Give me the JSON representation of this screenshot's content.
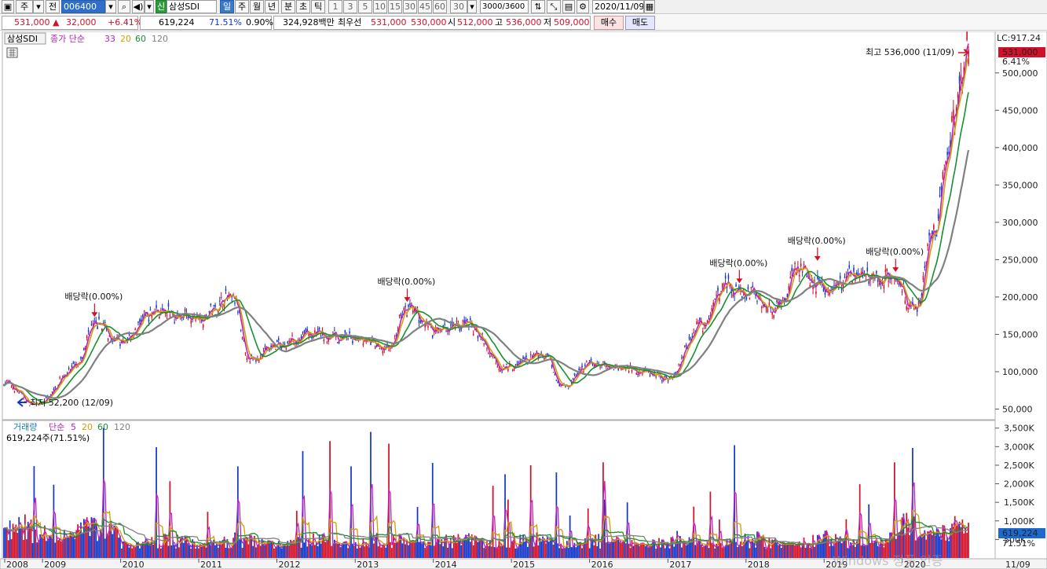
{
  "toolbar": {
    "market": "주",
    "prev_label": "전",
    "code": "006400",
    "stock_badge": "신",
    "stock_name": "삼성SDI",
    "periods": [
      "일",
      "주",
      "월",
      "년",
      "분",
      "초",
      "틱"
    ],
    "active_period": "일",
    "intervals": [
      "1",
      "3",
      "5",
      "10",
      "15",
      "30",
      "45",
      "60"
    ],
    "interval_value": "30",
    "count": "3000",
    "count_max": "3600",
    "date": "2020/11/09"
  },
  "quote": {
    "price": "531,000",
    "change": "32,000",
    "change_pct": "+6.41%",
    "volume": "619,224",
    "volume_ratio": "71.51%",
    "turnover": "0.90%",
    "amount": "324,928백만",
    "best_bid_label": "최우선",
    "best_ask": "531,000",
    "best_bid": "530,000",
    "open_label": "시",
    "open": "512,000",
    "high_label": "고",
    "high": "536,000",
    "low_label": "저",
    "low": "509,000",
    "buy_label": "매수",
    "sell_label": "매도"
  },
  "price_panel": {
    "name_tag": "삼성SDI",
    "ma_prefix": "종가 단순",
    "ma_periods": [
      "33",
      "20",
      "60",
      "120"
    ],
    "ma_colors": [
      "#c020c0",
      "#d0a000",
      "#189030",
      "#808080"
    ],
    "lc_label": "LC:917.24",
    "current_price": "531,000",
    "current_pct": "6.41%",
    "high_annotation": "최고 536,000 (11/09)",
    "low_annotation": "최저 52,200 (12/09)",
    "dividend_label": "배당락(0.00%)",
    "y_ticks": [
      "500,000",
      "450,000",
      "400,000",
      "350,000",
      "300,000",
      "250,000",
      "200,000",
      "150,000",
      "100,000",
      "50,000"
    ]
  },
  "volume_panel": {
    "title": "거래량",
    "ma_prefix": "단순",
    "ma_periods": [
      "5",
      "20",
      "60",
      "120"
    ],
    "ma_colors": [
      "#c020c0",
      "#d0a000",
      "#189030",
      "#808080"
    ],
    "current": "619,224주(71.51%)",
    "current_value": "619,224",
    "current_pct": "71.51%",
    "y_ticks": [
      "3,500K",
      "3,000K",
      "2,500K",
      "2,000K",
      "1,500K",
      "1,000K",
      "500K"
    ]
  },
  "x_axis": {
    "labels": [
      "2008",
      "2009",
      "2010",
      "2011",
      "2012",
      "2013",
      "2014",
      "2015",
      "2016",
      "2017",
      "2018",
      "2019",
      "2020"
    ],
    "last_label": "11/09"
  },
  "watermark": "Windows 정품 인증",
  "colors": {
    "up": "#d2102a",
    "down": "#1437c8",
    "accent": "#2f6fc8"
  },
  "chart_data": {
    "type": "line",
    "title": "",
    "xlabel": "",
    "ylabel": "",
    "ylim": [
      40000,
      545000
    ],
    "x": [
      "2008-07",
      "2008-12",
      "2009-06",
      "2009-09",
      "2010-01",
      "2010-06",
      "2011-01",
      "2011-06",
      "2011-09",
      "2012-01",
      "2012-06",
      "2013-01",
      "2013-06",
      "2013-09",
      "2014-01",
      "2014-06",
      "2014-12",
      "2015-06",
      "2015-09",
      "2016-01",
      "2016-06",
      "2016-10",
      "2017-01",
      "2017-06",
      "2017-10",
      "2018-01",
      "2018-06",
      "2018-09",
      "2019-01",
      "2019-06",
      "2019-12",
      "2020-03",
      "2020-06",
      "2020-09",
      "2020-11"
    ],
    "series": [
      {
        "name": "종가",
        "values": [
          85000,
          55000,
          105000,
          165000,
          140000,
          180000,
          170000,
          200000,
          115000,
          135000,
          150000,
          145000,
          130000,
          185000,
          155000,
          165000,
          105000,
          125000,
          80000,
          110000,
          105000,
          100000,
          90000,
          160000,
          215000,
          205000,
          185000,
          240000,
          210000,
          230000,
          225000,
          180000,
          290000,
          430000,
          531000
        ]
      }
    ],
    "volume_ylim": [
      0,
      3600000
    ],
    "annotations": [
      {
        "label": "배당락(0.00%)",
        "x": "2009-09",
        "price": 165000
      },
      {
        "label": "배당락(0.00%)",
        "x": "2013-09",
        "price": 185000
      },
      {
        "label": "배당락(0.00%)",
        "x": "2017-12",
        "price": 210000
      },
      {
        "label": "배당락(0.00%)",
        "x": "2018-12",
        "price": 240000
      },
      {
        "label": "배당락(0.00%)",
        "x": "2019-12",
        "price": 225000
      }
    ]
  }
}
